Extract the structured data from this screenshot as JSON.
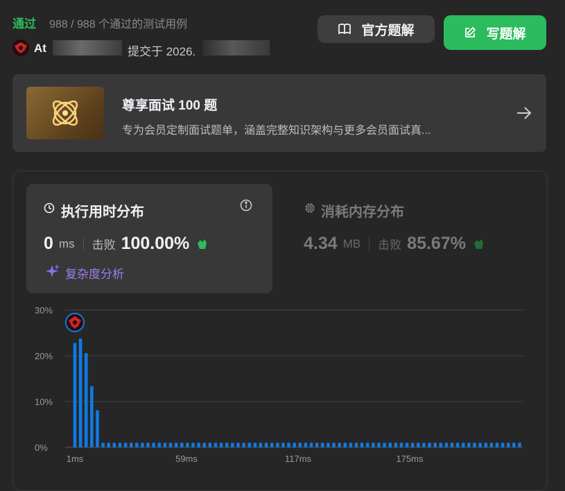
{
  "header": {
    "status": "通过",
    "status_detail": "988 / 988 个通过的测试用例",
    "author_prefix": "At",
    "submit_text": "提交于 2026."
  },
  "buttons": {
    "official_solution": "官方题解",
    "write_solution": "写题解"
  },
  "promo": {
    "title": "尊享面试 100 题",
    "subtitle": "专为会员定制面试题单，涵盖完整知识架构与更多会员面试真..."
  },
  "runtime": {
    "title": "执行用时分布",
    "value": "0",
    "unit": "ms",
    "beat_label": "击败",
    "beat_value": "100.00%",
    "complexity_link": "复杂度分析"
  },
  "memory": {
    "title": "消耗内存分布",
    "value": "4.34",
    "unit": "MB",
    "beat_label": "击败",
    "beat_value": "85.67%"
  },
  "colors": {
    "accent_green": "#2cbb5d",
    "bar_blue": "#0f7ae5",
    "purple": "#9b7df0"
  },
  "icons": [
    "book-icon",
    "edit-icon",
    "arrow-right-icon",
    "clock-icon",
    "info-icon",
    "chip-icon",
    "clap-icon",
    "sparkle-icon",
    "avatar"
  ],
  "chart_data": {
    "type": "bar",
    "ylabels": [
      "30%",
      "20%",
      "10%",
      "0%"
    ],
    "ylim": [
      0,
      30
    ],
    "xlabels": [
      "1ms",
      "59ms",
      "117ms",
      "175ms"
    ],
    "values": [
      22.8,
      23.8,
      20.6,
      13.4,
      8.1,
      1,
      1,
      1,
      1,
      1,
      1,
      1,
      1,
      1,
      1,
      1,
      1,
      1,
      1,
      1,
      1,
      1,
      1,
      1,
      1,
      1,
      1,
      1,
      1,
      1,
      1,
      1,
      1,
      1,
      1,
      1,
      1,
      1,
      1,
      1,
      1,
      1,
      1,
      1,
      1,
      1,
      1,
      1,
      1,
      1,
      1,
      1,
      1,
      1,
      1,
      1,
      1,
      1,
      1,
      1,
      1,
      1,
      1,
      1,
      1,
      1,
      1,
      1,
      1,
      1,
      1,
      1,
      1,
      1,
      1,
      1,
      1,
      1,
      1,
      1
    ],
    "grid": true
  }
}
